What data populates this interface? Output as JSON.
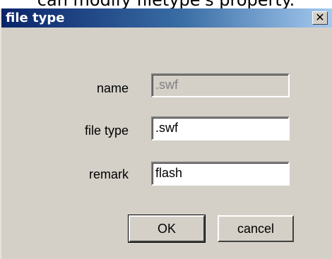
{
  "caption": "can modify filetype's property.",
  "window": {
    "title": "file type"
  },
  "icons": {
    "close": "close-icon"
  },
  "fields": {
    "name": {
      "label": "name",
      "value": ".swf"
    },
    "file_type": {
      "label": "file type",
      "value": ".swf"
    },
    "remark": {
      "label": "remark",
      "value": "flash"
    }
  },
  "buttons": {
    "ok": "OK",
    "cancel": "cancel"
  }
}
